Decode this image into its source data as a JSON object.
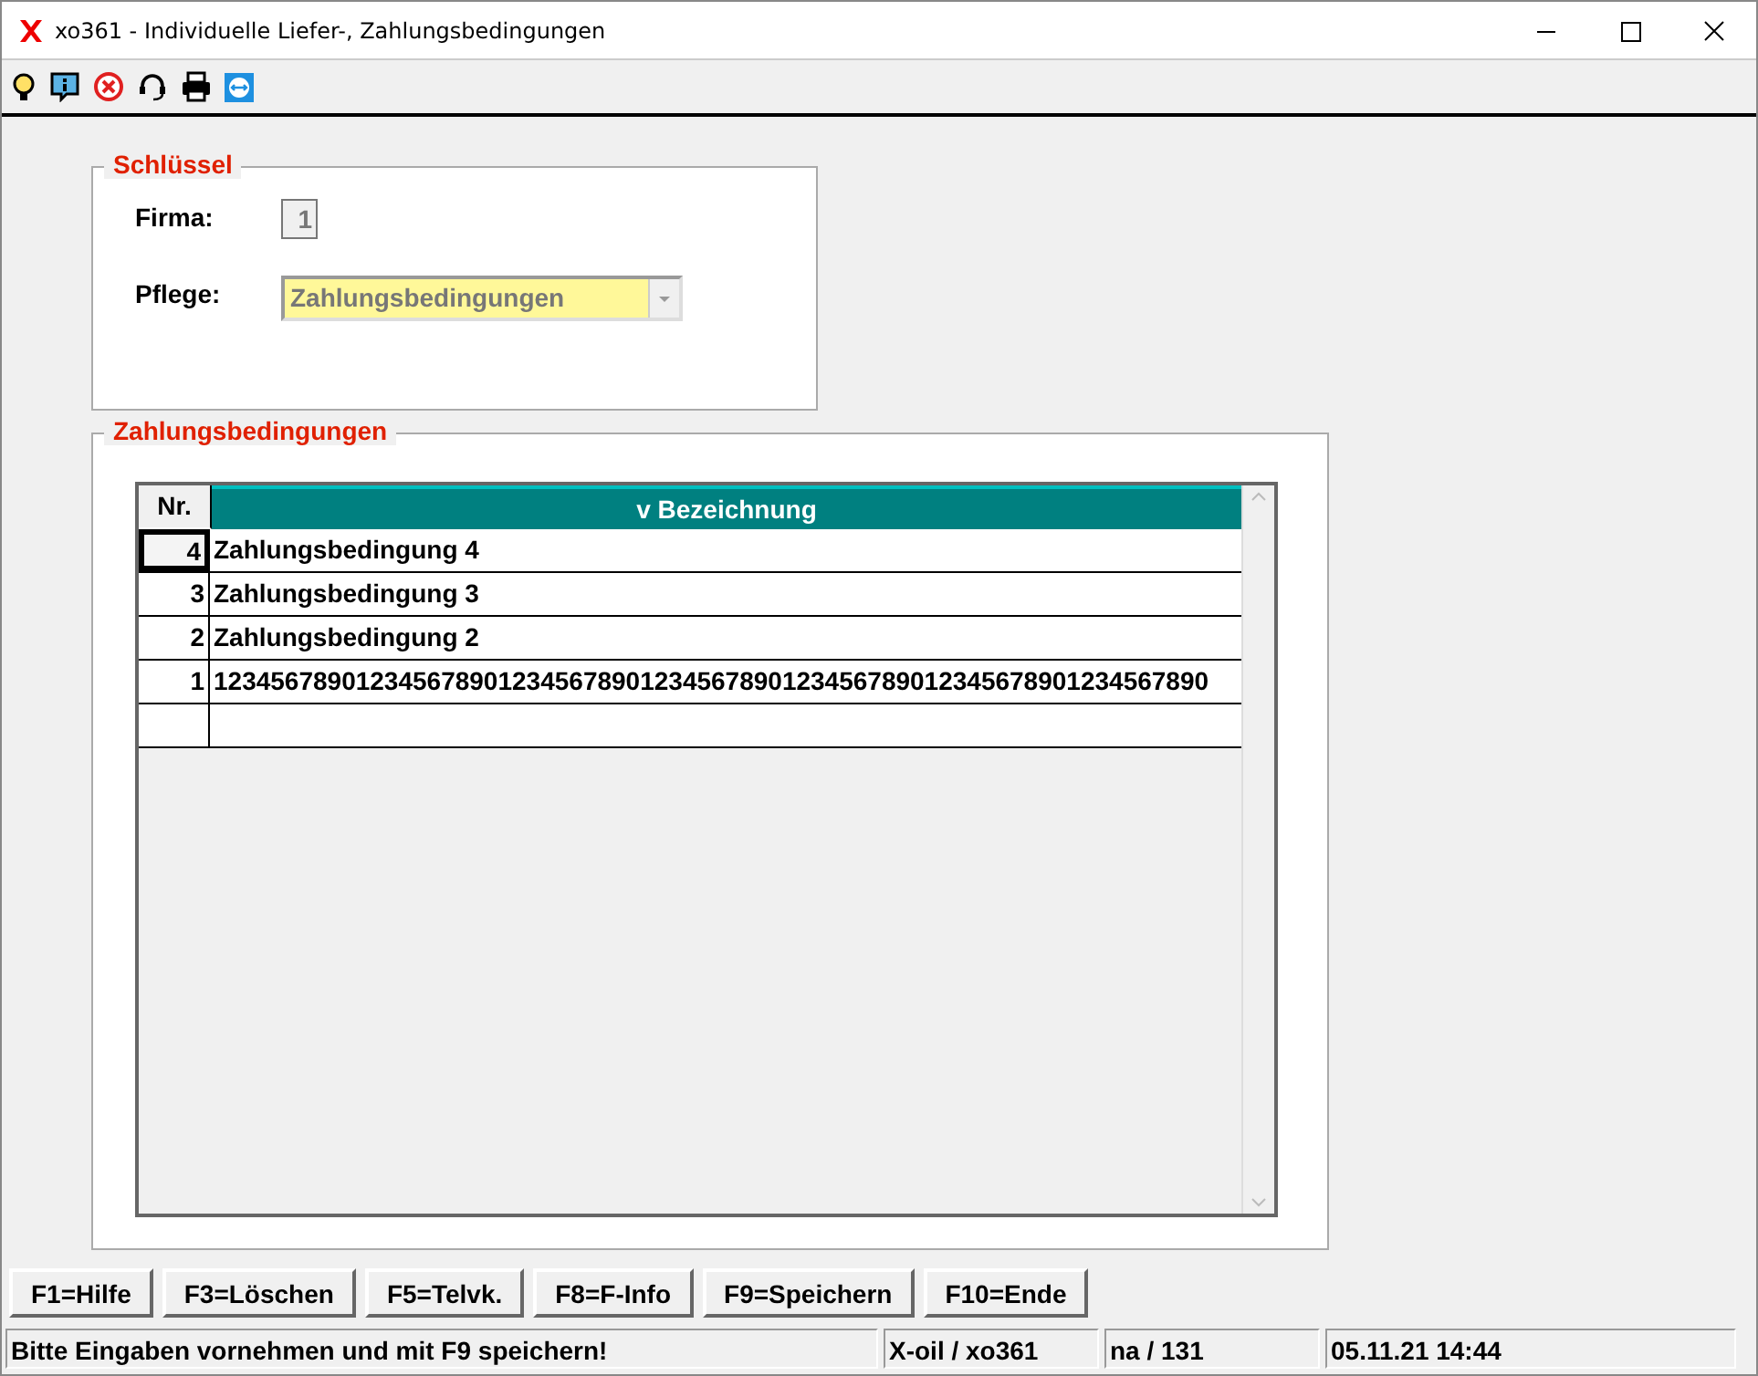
{
  "window": {
    "title": "xo361 - Individuelle Liefer-, Zahlungsbedingungen"
  },
  "toolbar": [
    {
      "kind": "bulb"
    },
    {
      "kind": "info"
    },
    {
      "kind": "cancel"
    },
    {
      "kind": "headset"
    },
    {
      "kind": "print"
    },
    {
      "kind": "remote"
    }
  ],
  "key_group": {
    "title": "Schlüssel",
    "firma_label": "Firma:",
    "firma_value": "1",
    "pflege_label": "Pflege:",
    "pflege_value": "Zahlungsbedingungen"
  },
  "list_group": {
    "title": "Zahlungsbedingungen",
    "columns": [
      "Nr.",
      "v Bezeichnung"
    ],
    "rows": [
      {
        "nr": "4",
        "text": "Zahlungsbedingung 4",
        "selected": true
      },
      {
        "nr": "3",
        "text": "Zahlungsbedingung 3",
        "selected": false
      },
      {
        "nr": "2",
        "text": "Zahlungsbedingung 2",
        "selected": false
      },
      {
        "nr": "1",
        "text": "1234567890123456789012345678901234567890123456789012345678901234567890",
        "selected": false
      }
    ]
  },
  "buttons": [
    "F1=Hilfe",
    "F3=Löschen",
    "F5=Telvk.",
    "F8=F-Info",
    "F9=Speichern",
    "F10=Ende"
  ],
  "status_bar": [
    "Bitte Eingaben vornehmen und mit F9 speichern!",
    "X-oil / xo361",
    "na / 131",
    "05.11.21 14:44"
  ]
}
